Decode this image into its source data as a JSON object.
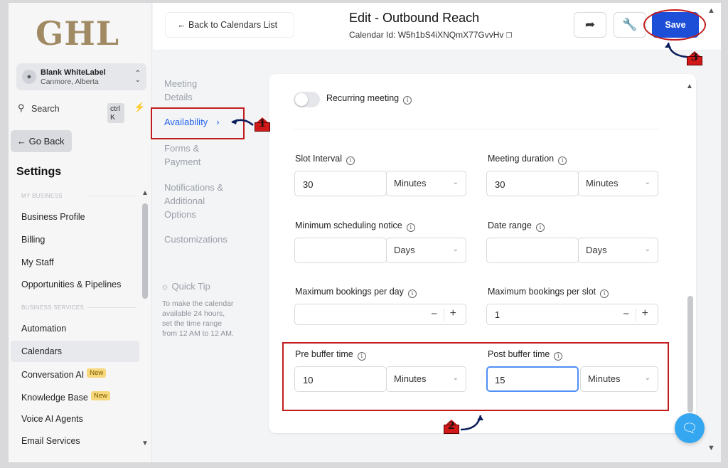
{
  "sidebar": {
    "logo": "GHL",
    "account": {
      "name": "Blank WhiteLabel",
      "location": "Canmore, Alberta"
    },
    "search": {
      "label": "Search",
      "shortcut": "ctrl K"
    },
    "go_back": "← Go Back",
    "settings_title": "Settings",
    "sections": [
      "MY BUSINESS",
      "BUSINESS SERVICES"
    ],
    "items": [
      {
        "label": "Business Profile"
      },
      {
        "label": "Billing"
      },
      {
        "label": "My Staff"
      },
      {
        "label": "Opportunities & Pipelines"
      },
      {
        "label": "Automation"
      },
      {
        "label": "Calendars"
      },
      {
        "label": "Conversation AI",
        "badge": "New"
      },
      {
        "label": "Knowledge Base",
        "badge": "New"
      },
      {
        "label": "Voice AI Agents"
      },
      {
        "label": "Email Services"
      }
    ]
  },
  "header": {
    "back_label": "Back to Calendars List",
    "title": "Edit - Outbound Reach",
    "calendar_id": "Calendar Id: W5h1bS4iXNQmX77GvvHv",
    "save_label": "Save"
  },
  "subnav": {
    "items": [
      "Meeting Details",
      "Availability",
      "Forms & Payment",
      "Notifications & Additional Options",
      "Customizations"
    ],
    "active": "Availability",
    "quick_tip_title": "Quick Tip",
    "quick_tip_text": "To make the calendar available 24 hours, set the time range from 12 AM to 12 AM."
  },
  "form": {
    "recurring_label": "Recurring meeting",
    "slot_interval": {
      "label": "Slot Interval",
      "value": "30",
      "unit": "Minutes"
    },
    "meeting_duration": {
      "label": "Meeting duration",
      "value": "30",
      "unit": "Minutes"
    },
    "min_notice": {
      "label": "Minimum scheduling notice",
      "value": "",
      "unit": "Days"
    },
    "date_range": {
      "label": "Date range",
      "value": "",
      "unit": "Days"
    },
    "max_per_day": {
      "label": "Maximum bookings per day",
      "value": ""
    },
    "max_per_slot": {
      "label": "Maximum bookings per slot",
      "value": "1"
    },
    "pre_buffer": {
      "label": "Pre buffer time",
      "value": "10",
      "unit": "Minutes"
    },
    "post_buffer": {
      "label": "Post buffer time",
      "value": "15",
      "unit": "Minutes"
    }
  },
  "annotations": [
    "1",
    "2",
    "3"
  ],
  "colors": {
    "accent": "#1d4ed8",
    "annotation": "#c21c1c",
    "logo": "#a08a63"
  }
}
